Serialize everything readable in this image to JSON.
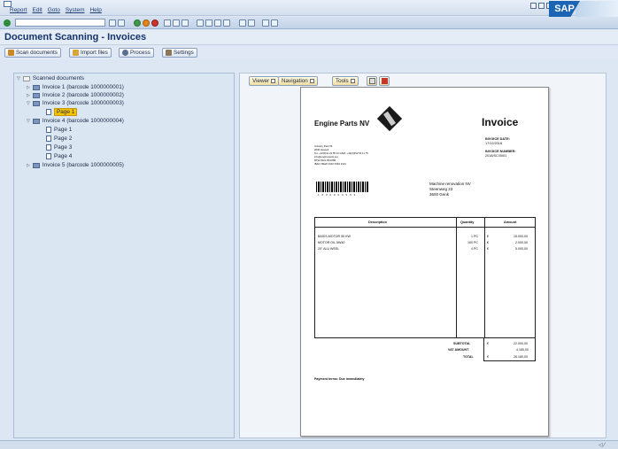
{
  "menubar": {
    "items": [
      "Report",
      "Edit",
      "Goto",
      "System",
      "Help"
    ],
    "logo": "SAP"
  },
  "page_title": "Document Scanning - Invoices",
  "app_toolbar": {
    "scan": "Scan documents",
    "import": "Import files",
    "process": "Process",
    "settings": "Settings"
  },
  "tree": {
    "root": "Scanned documents",
    "inv1": "Invoice 1 (barcode 1000000001)",
    "inv2": "Invoice 2 (barcode 1000000002)",
    "inv3": "Invoice 3 (barcode 1000000003)",
    "inv3_page1": "Page 1",
    "inv4": "Invoice 4 (barcode 1000000004)",
    "inv4_pages": [
      "Page 1",
      "Page 2",
      "Page 3",
      "Page 4"
    ],
    "inv5": "Invoice 5 (barcode 1000000005)"
  },
  "viewer_toolbar": {
    "viewer": "Viewer",
    "navigation": "Navigation",
    "tools": "Tools"
  },
  "invoice": {
    "company": "Engine Parts NV",
    "heading": "Invoice",
    "sender_lines": [
      "Industry Park 5b",
      "2000 Hasselt",
      "Tel: +32(0)11 23 55 44   GSM: +32(0)492 56 11 75",
      "info@engineparts.net",
      "BTW 0321.054.888",
      "IBAN: BE20 0140 5493 2101"
    ],
    "date_label": "INVOICE DATE:",
    "date_value": "17/12/2018",
    "number_label": "INVOICE NUMBER:",
    "number_value": "2018/SC/0001",
    "barcode_text": "1 0 0 0 0 0 0 0 0 3",
    "recipient": [
      "Machine renovation NV",
      "Steenweg 23",
      "3600 Genk"
    ],
    "columns": [
      "Description",
      "Quantity",
      "Amount"
    ],
    "lines": [
      {
        "desc": "BASIS-MOTOR 55 KW",
        "qty": "1 PC",
        "cur": "€",
        "amount": "15.000,00"
      },
      {
        "desc": "MOTOR OIL 5W40",
        "qty": "100 PC",
        "cur": "€",
        "amount": "2.000,00"
      },
      {
        "desc": "20\" ALU WEEL",
        "qty": "4 PC",
        "cur": "€",
        "amount": "5.000,00"
      }
    ],
    "subtotal_label": "SUBTOTAL",
    "subtotal_cur": "€",
    "subtotal": "22.000,00",
    "vat_label": "VAT AMOUNT",
    "vat": "4.180,00",
    "total_label": "TOTAL",
    "total_cur": "€",
    "total": "26.180,00",
    "payment_terms": "Payment terms: Due immediately"
  }
}
